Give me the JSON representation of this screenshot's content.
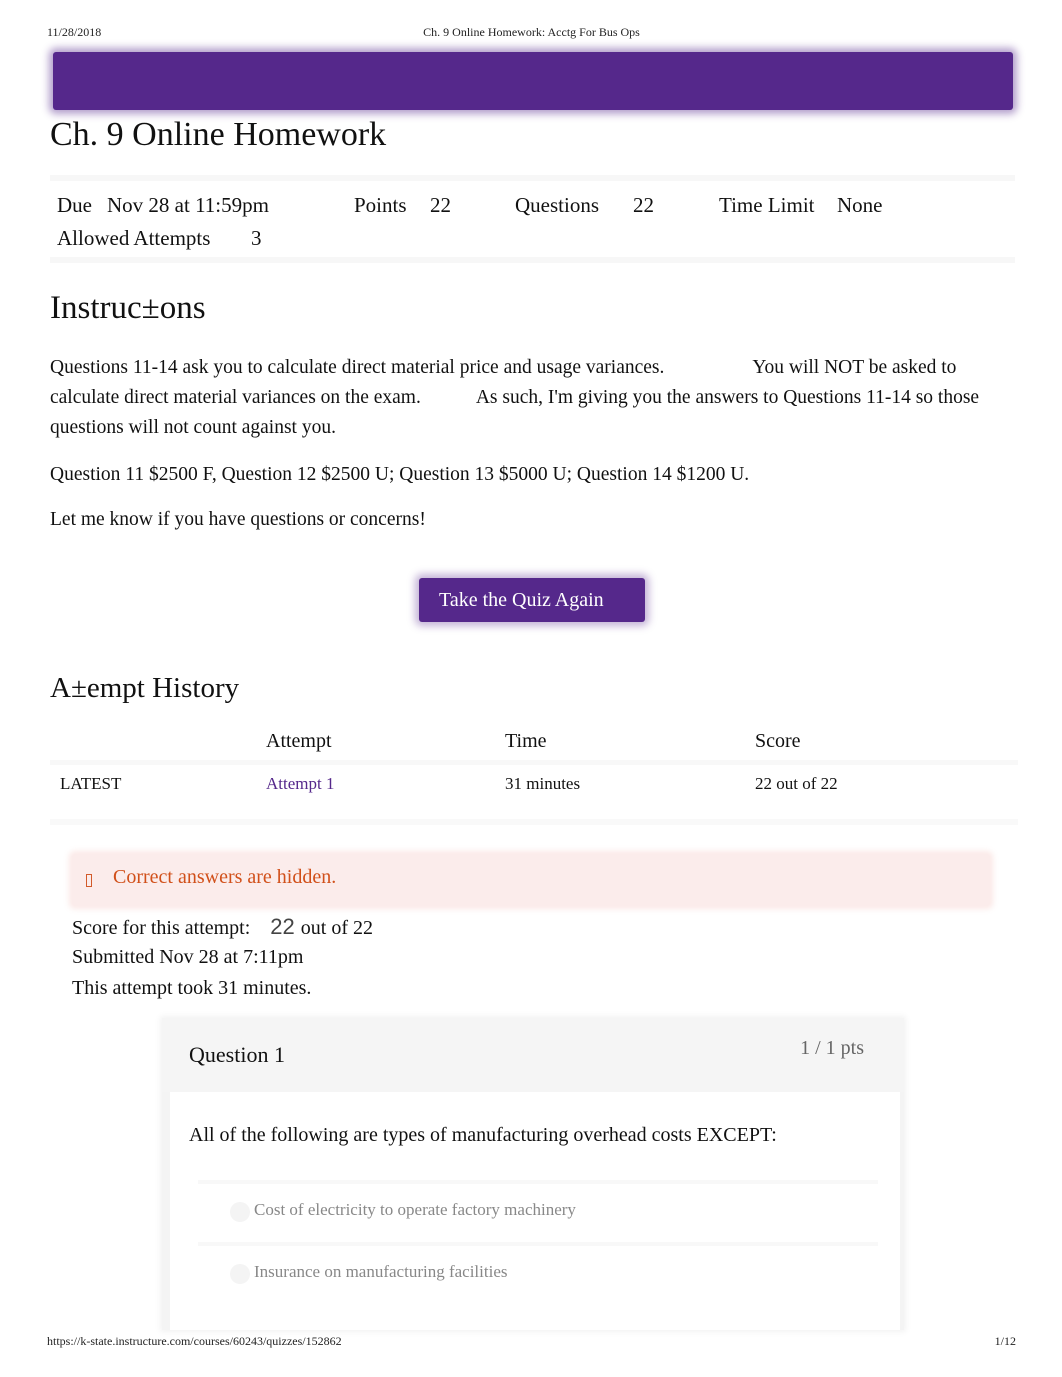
{
  "print_header": {
    "date": "11/28/2018",
    "title": "Ch. 9 Online Homework: Acctg For Bus Ops"
  },
  "brand_color": "#55288b",
  "page_title": "Ch. 9 Online Homework",
  "meta": {
    "due_label": "Due",
    "due_value": "Nov 28 at 11:59pm",
    "points_label": "Points",
    "points_value": "22",
    "questions_label": "Questions",
    "questions_value": "22",
    "time_limit_label": "Time Limit",
    "time_limit_value": "None",
    "allowed_attempts_label": "Allowed Attempts",
    "allowed_attempts_value": "3"
  },
  "instructions": {
    "heading": "Instruc±ons",
    "p1_a": "Questions 11-14 ask you to calculate direct material price and usage variances.",
    "p1_b": "You will NOT be asked to calculate direct material variances on the exam.",
    "p1_c": "As such, I'm giving you the answers to Questions 11-14 so those questions will not count against you.",
    "p2": "Question 11 $2500 F, Question 12 $2500 U; Question 13 $5000 U; Question 14 $1200 U.",
    "p3": "Let me know if you have questions or concerns!"
  },
  "take_quiz_button": "Take the Quiz Again",
  "attempt_history": {
    "heading": "A±empt History",
    "columns": [
      "Attempt",
      "Time",
      "Score"
    ],
    "rows": [
      {
        "label": "LATEST",
        "attempt": "Attempt 1",
        "time": "31 minutes",
        "score": "22 out of 22"
      }
    ]
  },
  "alert": {
    "icon": "warning-icon",
    "text": "Correct answers are hidden.",
    "color": "#d1501a"
  },
  "score_info": {
    "score_label": "Score for this attempt:",
    "score_value": "22",
    "score_total": "out of 22",
    "submitted": "Submitted Nov 28 at 7:11pm",
    "duration": "This attempt took 31 minutes."
  },
  "question": {
    "title": "Question 1",
    "points": "1 / 1 pts",
    "text": "All of the following are types of manufacturing overhead costs EXCEPT:",
    "answers": [
      "Cost of electricity to operate factory machinery",
      "Insurance on manufacturing facilities"
    ]
  },
  "print_footer": {
    "url": "https://k-state.instructure.com/courses/60243/quizzes/152862",
    "page": "1/12"
  }
}
